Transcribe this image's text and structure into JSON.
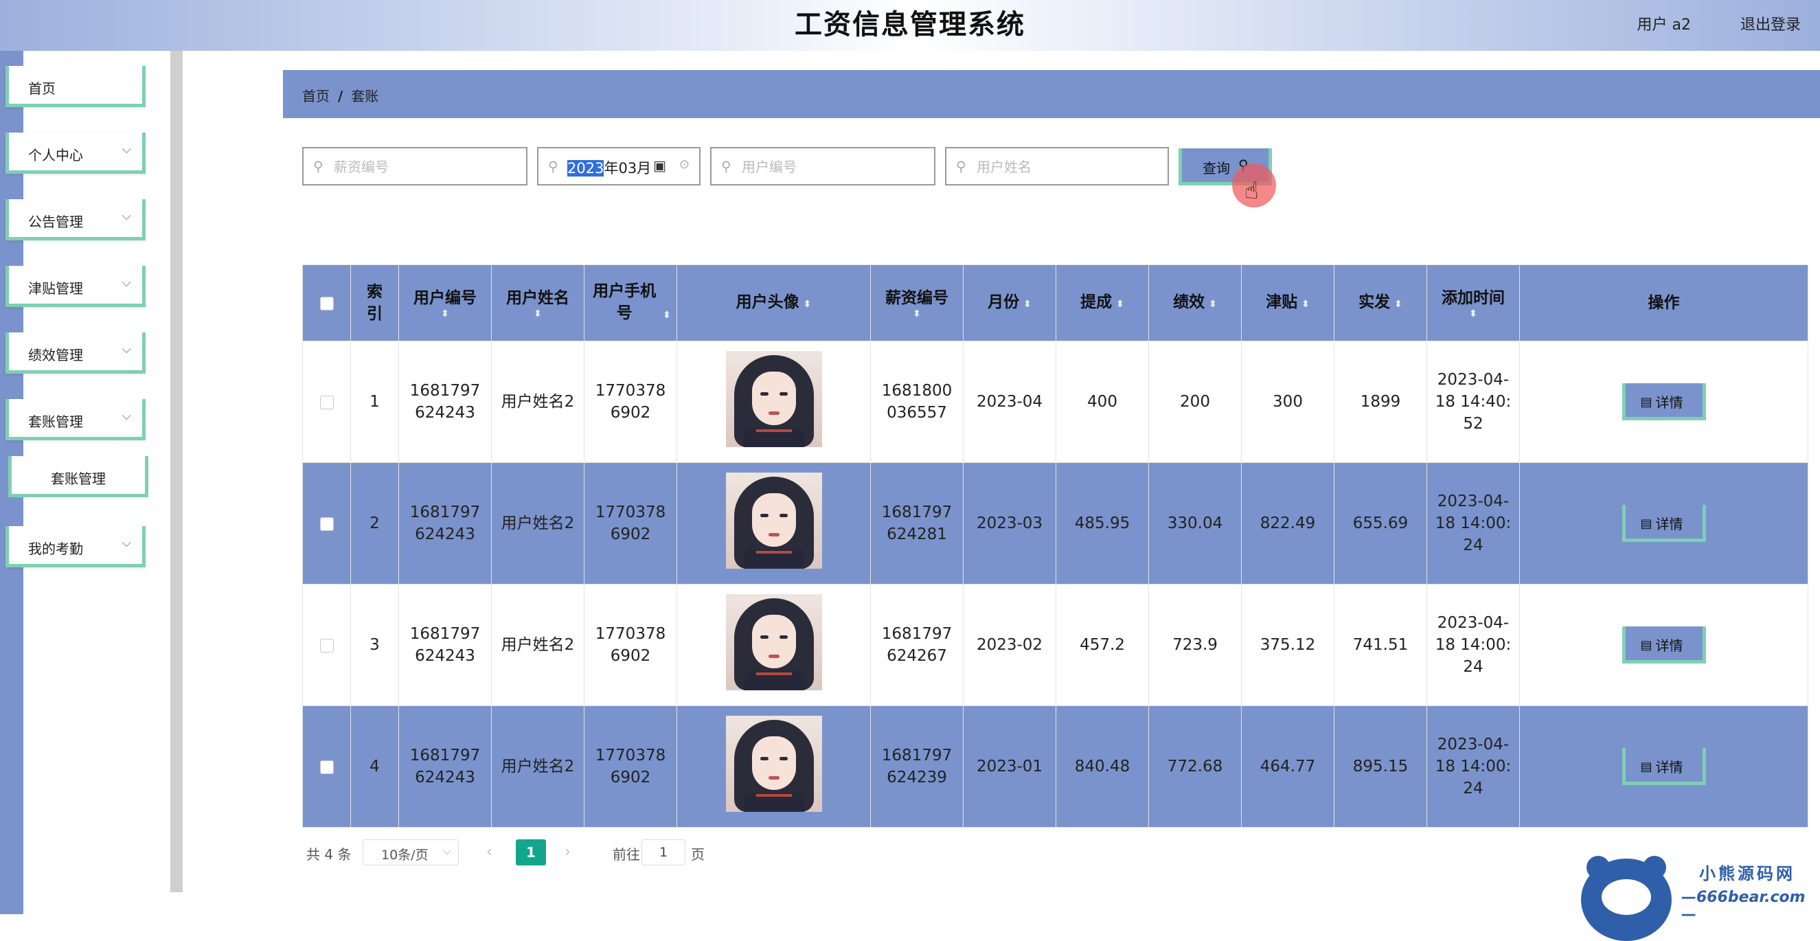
{
  "header": {
    "title": "工资信息管理系统",
    "user_label": "用户 a2",
    "logout_label": "退出登录"
  },
  "sidebar": {
    "items": [
      {
        "label": "首页",
        "has_children": false
      },
      {
        "label": "个人中心",
        "has_children": true
      },
      {
        "label": "公告管理",
        "has_children": true
      },
      {
        "label": "津贴管理",
        "has_children": true
      },
      {
        "label": "绩效管理",
        "has_children": true
      },
      {
        "label": "套账管理",
        "has_children": true
      },
      {
        "label": "我的考勤",
        "has_children": true
      }
    ],
    "submenu_label": "套账管理",
    "chevron_glyph": "⌵"
  },
  "breadcrumb": {
    "home": "首页",
    "separator": "/",
    "current": "套账"
  },
  "search": {
    "salary_no_placeholder": "薪资编号",
    "month_year": "2023",
    "month_rest": "年03月",
    "user_no_placeholder": "用户编号",
    "user_name_placeholder": "用户姓名",
    "query_label": "查询"
  },
  "icons": {
    "search": "⚲",
    "calendar": "▣",
    "clear": "⊙",
    "detail": "▤",
    "hand": "☝",
    "sort": "⬍"
  },
  "colors": {
    "accent_blue": "#7a93cc",
    "accent_green": "#7fcfb4",
    "pager_active": "#12a68c"
  },
  "table": {
    "headers": {
      "index": "索引",
      "user_no": "用户编号",
      "user_name": "用户姓名",
      "phone": "用户手机号",
      "avatar": "用户头像",
      "salary_no": "薪资编号",
      "month": "月份",
      "commission": "提成",
      "performance": "绩效",
      "allowance": "津贴",
      "net_pay": "实发",
      "added_time": "添加时间",
      "actions": "操作"
    },
    "detail_label": "详情",
    "rows": [
      {
        "index": "1",
        "user_no": "1681797624243",
        "user_name": "用户姓名2",
        "phone": "17703786902",
        "salary_no": "1681800036557",
        "month": "2023-04",
        "commission": "400",
        "performance": "200",
        "allowance": "300",
        "net_pay": "1899",
        "added_time": "2023-04-18 14:40:52"
      },
      {
        "index": "2",
        "user_no": "1681797624243",
        "user_name": "用户姓名2",
        "phone": "17703786902",
        "salary_no": "1681797624281",
        "month": "2023-03",
        "commission": "485.95",
        "performance": "330.04",
        "allowance": "822.49",
        "net_pay": "655.69",
        "added_time": "2023-04-18 14:00:24"
      },
      {
        "index": "3",
        "user_no": "1681797624243",
        "user_name": "用户姓名2",
        "phone": "17703786902",
        "salary_no": "1681797624267",
        "month": "2023-02",
        "commission": "457.2",
        "performance": "723.9",
        "allowance": "375.12",
        "net_pay": "741.51",
        "added_time": "2023-04-18 14:00:24"
      },
      {
        "index": "4",
        "user_no": "1681797624243",
        "user_name": "用户姓名2",
        "phone": "17703786902",
        "salary_no": "1681797624239",
        "month": "2023-01",
        "commission": "840.48",
        "performance": "772.68",
        "allowance": "464.77",
        "net_pay": "895.15",
        "added_time": "2023-04-18 14:00:24"
      }
    ]
  },
  "pagination": {
    "total_label": "共 4 条",
    "page_size": "10条/页",
    "prev": "‹",
    "current_page": "1",
    "next": "›",
    "goto_prefix": "前往",
    "goto_value": "1",
    "goto_suffix": "页"
  },
  "watermark": {
    "title": "小熊源码网",
    "url": "—666bear.com—"
  }
}
